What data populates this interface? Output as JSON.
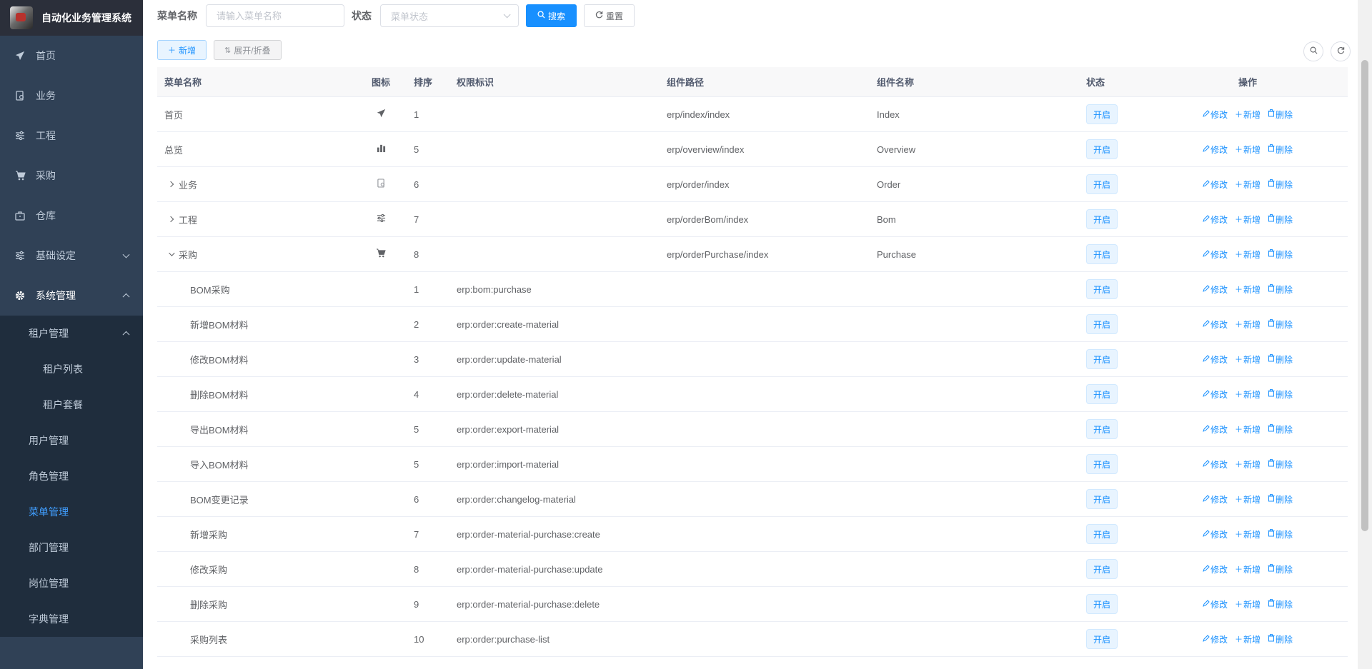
{
  "app": {
    "title": "自动化业务管理系统"
  },
  "sidebar": {
    "menu": [
      {
        "label": "首页",
        "icon": "paper-plane-icon"
      },
      {
        "label": "业务",
        "icon": "document-icon"
      },
      {
        "label": "工程",
        "icon": "sliders-icon"
      },
      {
        "label": "采购",
        "icon": "cart-icon"
      },
      {
        "label": "仓库",
        "icon": "box-icon"
      },
      {
        "label": "基础设定",
        "icon": "sliders-icon"
      },
      {
        "label": "系统管理",
        "icon": "gear-icon"
      }
    ],
    "system_sub": {
      "tenant": "租户管理",
      "tenant_list": "租户列表",
      "tenant_package": "租户套餐",
      "user": "用户管理",
      "role": "角色管理",
      "menu": "菜单管理",
      "dept": "部门管理",
      "post": "岗位管理",
      "dict": "字典管理"
    }
  },
  "search": {
    "name_label": "菜单名称",
    "name_placeholder": "请输入菜单名称",
    "status_label": "状态",
    "status_placeholder": "菜单状态",
    "search_btn": "搜索",
    "reset_btn": "重置"
  },
  "toolbar": {
    "add": "新增",
    "expand": "展开/折叠"
  },
  "table": {
    "headers": [
      "菜单名称",
      "图标",
      "排序",
      "权限标识",
      "组件路径",
      "组件名称",
      "状态",
      "操作"
    ],
    "actions": {
      "edit": "修改",
      "add": "新增",
      "delete": "删除"
    },
    "rows": [
      {
        "name": "首页",
        "icon": "paper-plane-icon",
        "sort": "1",
        "perm": "",
        "path": "erp/index/index",
        "component": "Index",
        "status": "开启"
      },
      {
        "name": "总览",
        "icon": "bar-chart-icon",
        "sort": "5",
        "perm": "",
        "path": "erp/overview/index",
        "component": "Overview",
        "status": "开启"
      },
      {
        "name": "业务",
        "icon": "document-icon",
        "sort": "6",
        "perm": "",
        "path": "erp/order/index",
        "component": "Order",
        "status": "开启"
      },
      {
        "name": "工程",
        "icon": "sliders-icon",
        "sort": "7",
        "perm": "",
        "path": "erp/orderBom/index",
        "component": "Bom",
        "status": "开启"
      },
      {
        "name": "采购",
        "icon": "cart-icon",
        "sort": "8",
        "perm": "",
        "path": "erp/orderPurchase/index",
        "component": "Purchase",
        "status": "开启"
      },
      {
        "name": "BOM采购",
        "icon": "",
        "sort": "1",
        "perm": "erp:bom:purchase",
        "path": "",
        "component": "",
        "status": "开启"
      },
      {
        "name": "新增BOM材料",
        "icon": "",
        "sort": "2",
        "perm": "erp:order:create-material",
        "path": "",
        "component": "",
        "status": "开启"
      },
      {
        "name": "修改BOM材料",
        "icon": "",
        "sort": "3",
        "perm": "erp:order:update-material",
        "path": "",
        "component": "",
        "status": "开启"
      },
      {
        "name": "删除BOM材料",
        "icon": "",
        "sort": "4",
        "perm": "erp:order:delete-material",
        "path": "",
        "component": "",
        "status": "开启"
      },
      {
        "name": "导出BOM材料",
        "icon": "",
        "sort": "5",
        "perm": "erp:order:export-material",
        "path": "",
        "component": "",
        "status": "开启"
      },
      {
        "name": "导入BOM材料",
        "icon": "",
        "sort": "5",
        "perm": "erp:order:import-material",
        "path": "",
        "component": "",
        "status": "开启"
      },
      {
        "name": "BOM变更记录",
        "icon": "",
        "sort": "6",
        "perm": "erp:order:changelog-material",
        "path": "",
        "component": "",
        "status": "开启"
      },
      {
        "name": "新增采购",
        "icon": "",
        "sort": "7",
        "perm": "erp:order-material-purchase:create",
        "path": "",
        "component": "",
        "status": "开启"
      },
      {
        "name": "修改采购",
        "icon": "",
        "sort": "8",
        "perm": "erp:order-material-purchase:update",
        "path": "",
        "component": "",
        "status": "开启"
      },
      {
        "name": "删除采购",
        "icon": "",
        "sort": "9",
        "perm": "erp:order-material-purchase:delete",
        "path": "",
        "component": "",
        "status": "开启"
      },
      {
        "name": "采购列表",
        "icon": "",
        "sort": "10",
        "perm": "erp:order:purchase-list",
        "path": "",
        "component": "",
        "status": "开启"
      }
    ]
  },
  "colors": {
    "primary": "#1890ff",
    "sidebar_bg": "#304156",
    "submenu_bg": "#1f2d3d",
    "active_text": "#409eff"
  }
}
